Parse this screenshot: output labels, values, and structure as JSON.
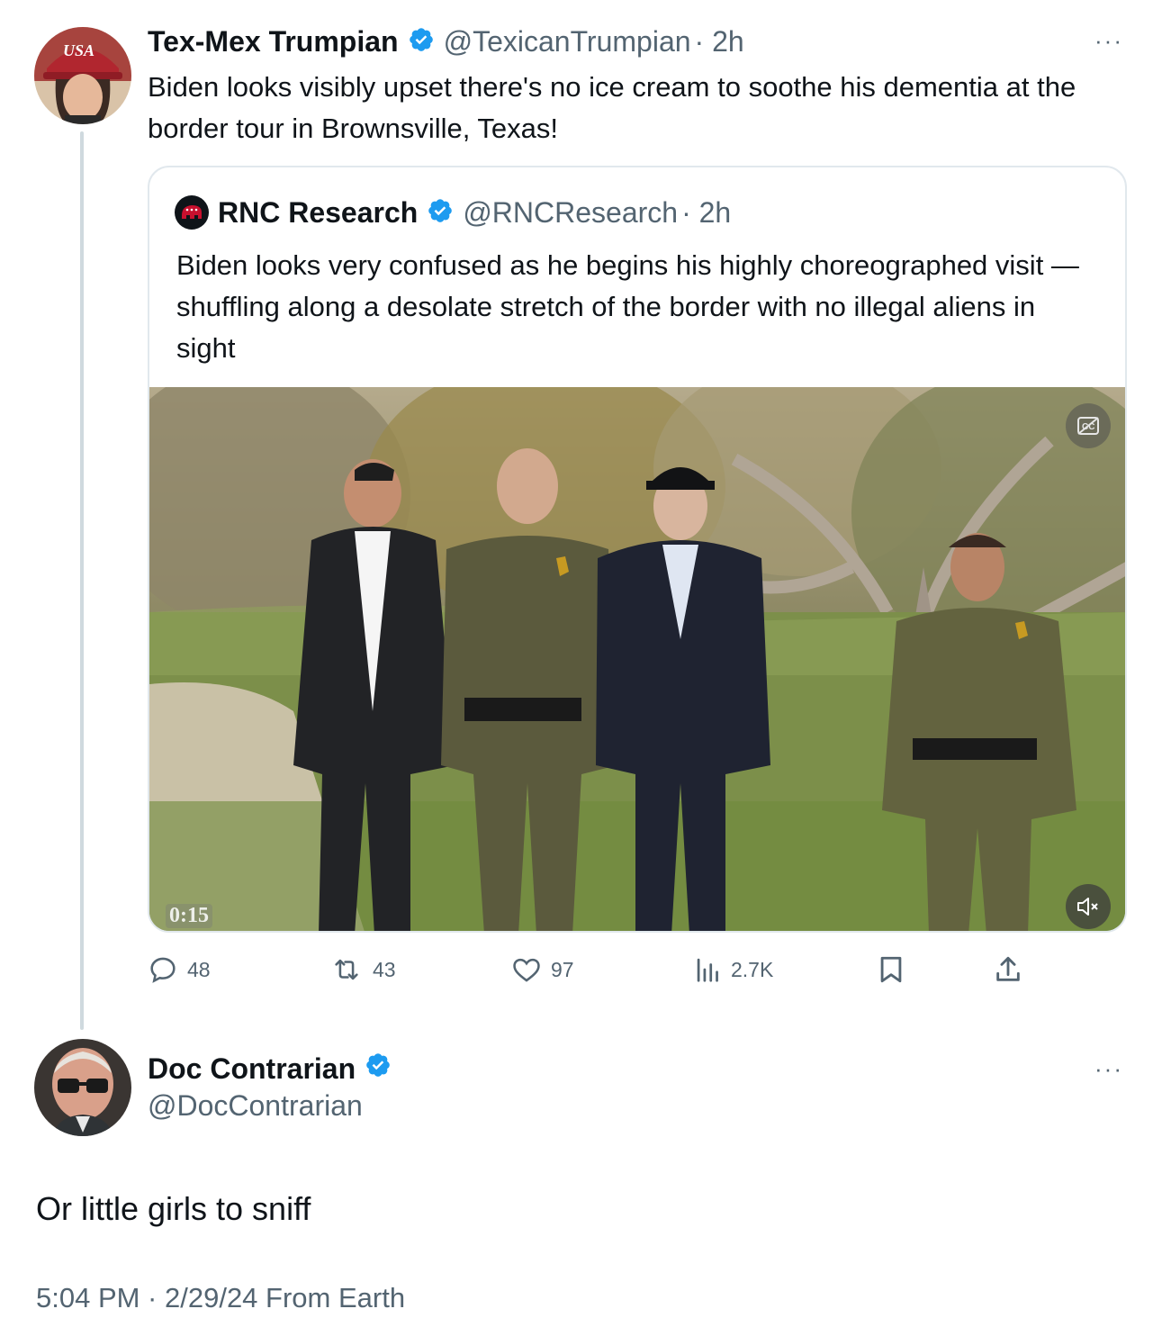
{
  "tweet": {
    "author_name": "Tex-Mex Trumpian",
    "author_handle": "@TexicanTrumpian",
    "time": "· 2h",
    "more": "···",
    "text": "Biden looks visibly upset there's no ice cream to soothe his dementia at the border tour in Brownsville, Texas!",
    "avatar_hat_text": "USA"
  },
  "quote": {
    "author_name": "RNC Research",
    "author_handle": "@RNCResearch",
    "time": "· 2h",
    "text": "Biden looks very confused as he begins his highly choreographed visit — shuffling along a desolate stretch of the border with no illegal aliens in sight",
    "video": {
      "timestamp": "0:15",
      "captions_icon": "closed-captions-icon",
      "mute_icon": "muted-speaker-icon"
    }
  },
  "actions": {
    "replies": "48",
    "reposts": "43",
    "likes": "97",
    "views": "2.7K"
  },
  "reply": {
    "author_name": "Doc Contrarian",
    "author_handle": "@DocContrarian",
    "more": "···",
    "text": "Or little girls to sniff"
  },
  "footer": {
    "text": "5:04 PM · 2/29/24 From Earth"
  },
  "colors": {
    "verified": "#1d9bf0",
    "secondary_text": "#536471",
    "thread_line": "#cfd9de",
    "rnc_red": "#c8102e"
  }
}
